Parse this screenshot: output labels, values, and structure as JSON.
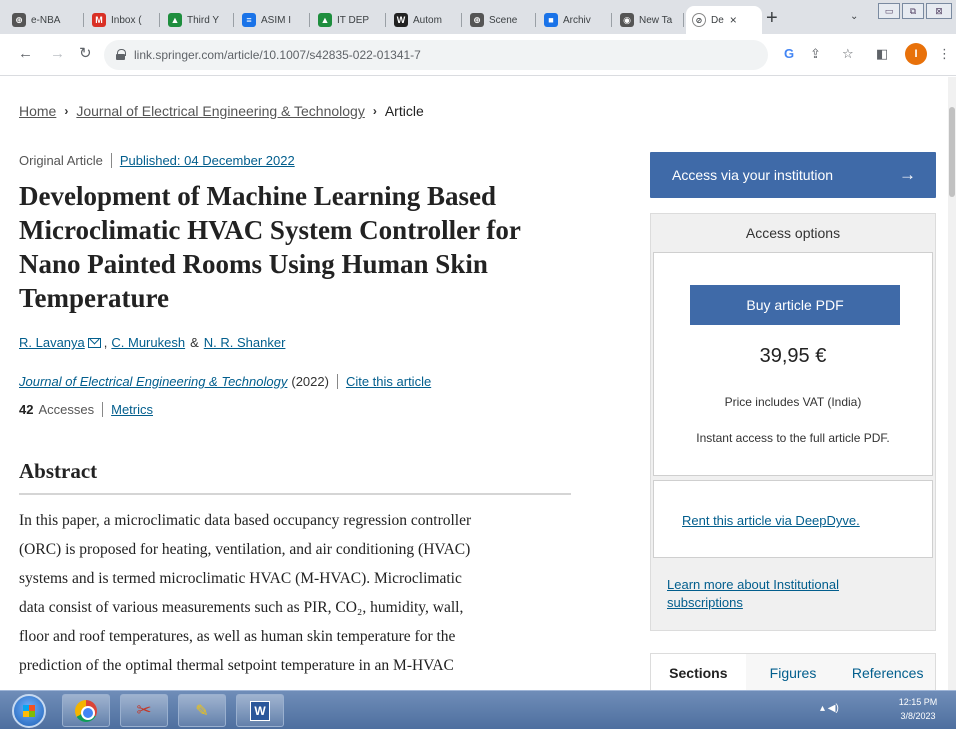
{
  "browser": {
    "tabs": [
      {
        "label": "e-NBA",
        "color": "#555555",
        "glyph": "⊕"
      },
      {
        "label": "Inbox (",
        "color": "#d93025",
        "glyph": "M"
      },
      {
        "label": "Third Y",
        "color": "#1e8e3e",
        "glyph": "▲"
      },
      {
        "label": "ASIM I",
        "color": "#1a73e8",
        "glyph": "≡"
      },
      {
        "label": "IT DEP",
        "color": "#1e8e3e",
        "glyph": "▲"
      },
      {
        "label": "Autom",
        "color": "#222222",
        "glyph": "W"
      },
      {
        "label": "Scene",
        "color": "#555555",
        "glyph": "⊕"
      },
      {
        "label": "Archiv",
        "color": "#1a73e8",
        "glyph": "■"
      },
      {
        "label": "New Ta",
        "color": "#555555",
        "glyph": "◉"
      }
    ],
    "active_tab": {
      "label": "De",
      "close": "×"
    },
    "new_tab": "+",
    "url": "link.springer.com/article/10.1007/s42835-022-01341-7",
    "avatar_letter": "I"
  },
  "breadcrumb": {
    "home": "Home",
    "journal": "Journal of Electrical Engineering & Technology",
    "current": "Article"
  },
  "article": {
    "type": "Original Article",
    "published": "Published: 04 December 2022",
    "title": "Development of Machine Learning Based Microclimatic HVAC System Controller for Nano Painted Rooms Using Human Skin Temperature",
    "authors": [
      "R. Lavanya",
      "C. Murukesh",
      "N. R. Shanker"
    ],
    "author_sep1": ",",
    "author_sep2": "&",
    "journal": "Journal of Electrical Engineering & Technology",
    "year": "(2022)",
    "cite": "Cite this article",
    "accesses_count": "42",
    "accesses_label": "Accesses",
    "metrics": "Metrics",
    "abstract_heading": "Abstract",
    "abstract_lines": [
      "In this paper, a microclimatic data based occupancy regression controller",
      "(ORC) is proposed for heating, ventilation, and air conditioning (HVAC)",
      "systems and is termed microclimatic HVAC (M-HVAC). Microclimatic",
      "data consist of various measurements such as PIR, CO₂, humidity, wall,",
      "floor and roof temperatures, as well as human skin temperature for the",
      "prediction of the optimal thermal setpoint temperature in an M-HVAC"
    ]
  },
  "sidebar": {
    "access_institution": "Access via your institution",
    "access_arrow": "→",
    "access_options": "Access options",
    "buy_pdf": "Buy article PDF",
    "price": "39,95 €",
    "vat_note": "Price includes VAT (India)",
    "instant_note": "Instant access to the full article PDF.",
    "rent": "Rent this article via DeepDyve.",
    "learn_more": "Learn more about Institutional subscriptions",
    "tabs": [
      "Sections",
      "Figures",
      "References"
    ]
  },
  "taskbar": {
    "time": "12:15 PM",
    "date": "3/8/2023"
  }
}
